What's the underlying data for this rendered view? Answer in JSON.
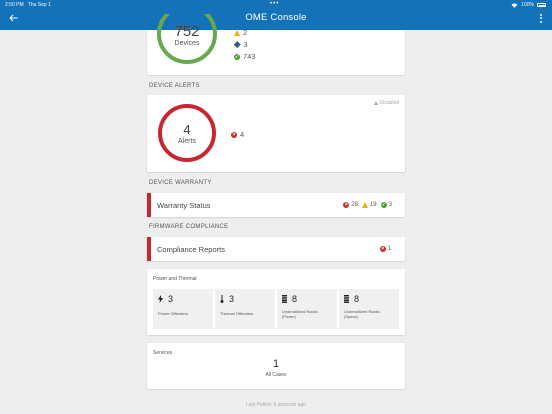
{
  "status_bar": {
    "time": "2:50 PM",
    "date": "Thu Sep 1",
    "battery": "100%"
  },
  "header": {
    "title": "OME Console"
  },
  "devices": {
    "count": "752",
    "label": "Devices",
    "warning": "2",
    "unknown": "3",
    "ok": "743",
    "ring_color": "#6aa84f"
  },
  "alerts": {
    "section": "DEVICE ALERTS",
    "disabled_label": "Disabled",
    "count": "4",
    "label": "Alerts",
    "critical": "4",
    "ring_color": "#c62833"
  },
  "warranty": {
    "section": "DEVICE WARRANTY",
    "label": "Warranty Status",
    "critical": "28",
    "warning": "19",
    "ok": "3"
  },
  "firmware": {
    "section": "FIRMWARE COMPLIANCE",
    "label": "Compliance Reports",
    "critical": "1"
  },
  "power_thermal": {
    "title": "Power and Thermal",
    "tiles": [
      {
        "value": "3",
        "label": "Power Offenders",
        "icon": "bolt-icon"
      },
      {
        "value": "3",
        "label": "Thermal Offenders",
        "icon": "thermometer-icon"
      },
      {
        "value": "8",
        "label": "Underutilized Racks (Power)",
        "icon": "rack-icon"
      },
      {
        "value": "8",
        "label": "Underutilized Racks (Space)",
        "icon": "rack-icon"
      }
    ]
  },
  "services": {
    "title": "Services",
    "count": "1",
    "label": "All Cases"
  },
  "footer": {
    "last_polled": "Last Polled: 6 seconds ago"
  },
  "colors": {
    "header": "#1473b8",
    "critical": "#cc2c2c",
    "warning": "#f0b400",
    "ok": "#4a9d2f"
  }
}
